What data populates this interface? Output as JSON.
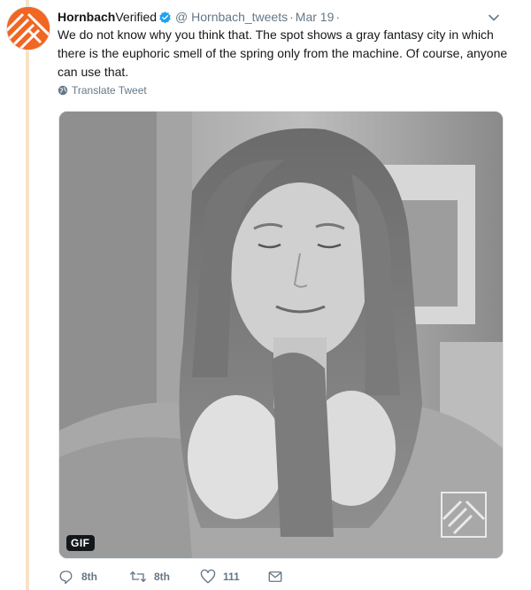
{
  "tweet": {
    "display_name": "Hornbach",
    "verified_label": "Verified",
    "handle": "@ Hornbach_tweets",
    "separator": "·",
    "date": "Mar 19",
    "trailing_dot": "·",
    "text": "We do not know why you think that. The spot shows a gray fantasy city in which there is the euphoric smell of the spring only from the machine. Of course, anyone can use that.",
    "translate_label": "Translate Tweet",
    "media_badge": "GIF",
    "brand_color": "#f26622",
    "verified_color": "#1da1f2"
  },
  "actions": {
    "reply_count": "8th",
    "retweet_count": "8th",
    "like_count": "111"
  },
  "icons": {
    "caret": "chevron-down-icon",
    "verified": "verified-badge-icon",
    "globe": "globe-icon",
    "reply": "reply-icon",
    "retweet": "retweet-icon",
    "like": "heart-icon",
    "message": "envelope-icon"
  }
}
